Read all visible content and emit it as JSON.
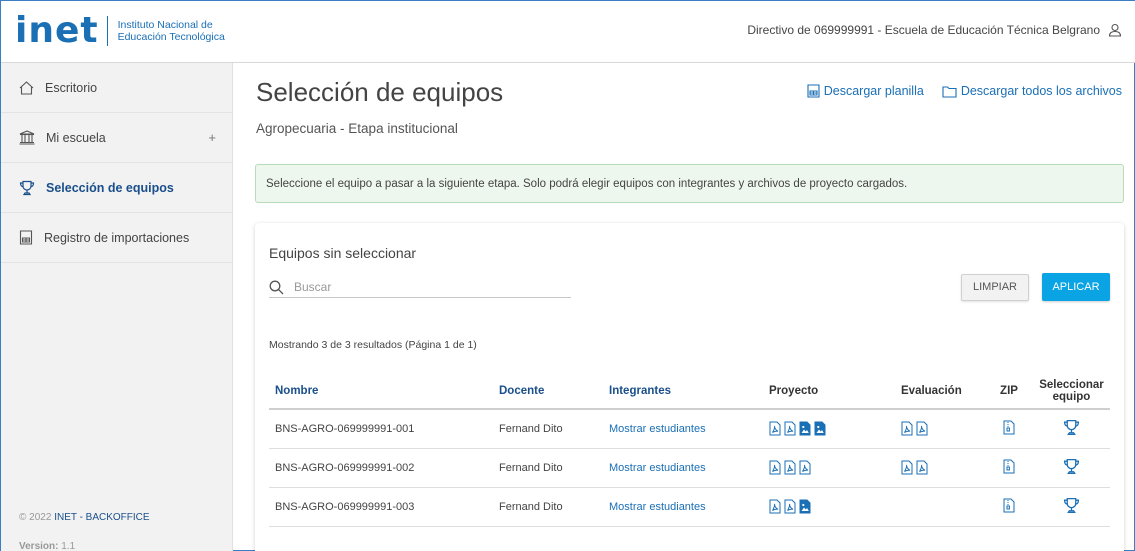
{
  "header": {
    "logo_text": "inet",
    "logo_sub_line1": "Instituto Nacional de",
    "logo_sub_line2": "Educación Tecnológica",
    "user_text": "Directivo de 069999991 - Escuela de Educación Técnica Belgrano",
    "user_icon": "user-icon"
  },
  "sidebar": {
    "items": [
      {
        "label": "Escritorio",
        "icon": "home-icon"
      },
      {
        "label": "Mi escuela",
        "icon": "school-icon",
        "expand": "+"
      },
      {
        "label": "Selección de equipos",
        "icon": "trophy-icon"
      },
      {
        "label": "Registro de importaciones",
        "icon": "spreadsheet-icon"
      }
    ],
    "copyright_prefix": "© 2022",
    "copyright_link": "INET - BACKOFFICE",
    "version_label": "Version:",
    "version_value": "1.1"
  },
  "main": {
    "title": "Selección de equipos",
    "subtitle": "Agropecuaria - Etapa institucional",
    "download_template": "Descargar planilla",
    "download_all": "Descargar todos los archivos",
    "alert": "Seleccione el equipo a pasar a la siguiente etapa. Solo podrá elegir equipos con integrantes y archivos de proyecto cargados."
  },
  "card": {
    "title": "Equipos sin seleccionar",
    "search_placeholder": "Buscar",
    "clear_label": "LIMPIAR",
    "apply_label": "APLICAR",
    "results_text": "Mostrando 3 de 3 resultados (Página 1 de 1)"
  },
  "table": {
    "headers": {
      "nombre": "Nombre",
      "docente": "Docente",
      "integrantes": "Integrantes",
      "proyecto": "Proyecto",
      "evaluacion": "Evaluación",
      "zip": "ZIP",
      "seleccionar_1": "Seleccionar",
      "seleccionar_2": "equipo"
    },
    "rows": [
      {
        "nombre": "BNS-AGRO-069999991-001",
        "docente": "Fernand Dito",
        "integrantes": "Mostrar estudiantes",
        "proyecto": [
          "pdf",
          "pdf",
          "image",
          "image"
        ],
        "evaluacion": [
          "pdf",
          "pdf"
        ],
        "zip": true
      },
      {
        "nombre": "BNS-AGRO-069999991-002",
        "docente": "Fernand Dito",
        "integrantes": "Mostrar estudiantes",
        "proyecto": [
          "pdf",
          "pdf",
          "pdf"
        ],
        "evaluacion": [
          "pdf",
          "pdf"
        ],
        "zip": true
      },
      {
        "nombre": "BNS-AGRO-069999991-003",
        "docente": "Fernand Dito",
        "integrantes": "Mostrar estudiantes",
        "proyecto": [
          "pdf",
          "pdf",
          "image"
        ],
        "evaluacion": [],
        "zip": true
      }
    ]
  },
  "colors": {
    "brand": "#1a6fb5",
    "nav_active": "#1a4f8b",
    "apply_button": "#0aa3e4",
    "alert_bg": "#eef7ee",
    "alert_border": "#b8dcb9"
  }
}
